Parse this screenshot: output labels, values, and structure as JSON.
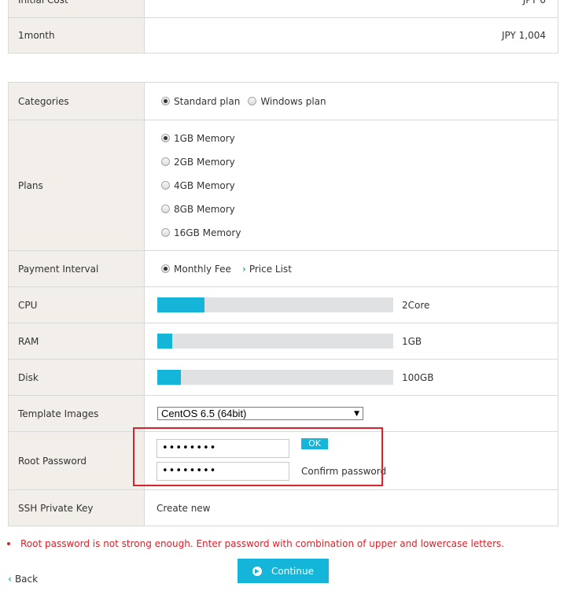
{
  "cost": {
    "rows": [
      {
        "label": "Initial Cost",
        "value": "JPY 0"
      },
      {
        "label": "1month",
        "value": "JPY 1,004"
      }
    ]
  },
  "categories": {
    "label": "Categories",
    "options": [
      {
        "label": "Standard plan",
        "selected": true
      },
      {
        "label": "Windows plan",
        "selected": false
      }
    ]
  },
  "plans": {
    "label": "Plans",
    "options": [
      {
        "label": "1GB Memory",
        "selected": true
      },
      {
        "label": "2GB Memory",
        "selected": false
      },
      {
        "label": "4GB Memory",
        "selected": false
      },
      {
        "label": "8GB Memory",
        "selected": false
      },
      {
        "label": "16GB Memory",
        "selected": false
      }
    ]
  },
  "payment": {
    "label": "Payment Interval",
    "option": "Monthly Fee",
    "price_list": "Price List"
  },
  "cpu": {
    "label": "CPU",
    "value": "2Core",
    "fill_fraction": 0.2
  },
  "ram": {
    "label": "RAM",
    "value": "1GB",
    "fill_fraction": 0.0633
  },
  "disk": {
    "label": "Disk",
    "value": "100GB",
    "fill_fraction": 0.1
  },
  "template": {
    "label": "Template Images",
    "selected": "CentOS 6.5 (64bit)"
  },
  "root_password": {
    "label": "Root Password",
    "password_value": "••••••••",
    "confirm_value": "••••••••",
    "ok_badge": "OK",
    "confirm_label": "Confirm password"
  },
  "ssh": {
    "label": "SSH Private Key",
    "value": "Create new"
  },
  "error": {
    "message": "Root password is not strong enough. Enter password with combination of upper and lowercase letters."
  },
  "actions": {
    "continue": "Continue",
    "back": "Back"
  },
  "colors": {
    "accent": "#14b5d9",
    "error": "#d9222a",
    "label_bg": "#f2eeea",
    "bar_track": "#dfe1e3"
  }
}
